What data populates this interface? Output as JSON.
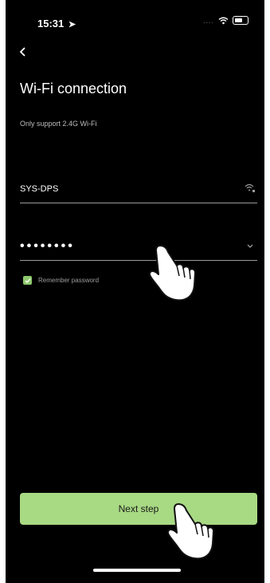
{
  "status_bar": {
    "time": "15:31",
    "location_arrow": "location-arrow-icon",
    "signal_dots": "....",
    "icons": [
      "wifi-icon",
      "battery-icon"
    ]
  },
  "header": {
    "back_icon": "chevron-left-icon",
    "title": "Wi-Fi connection",
    "subtitle": "Only support 2.4G Wi-Fi"
  },
  "form": {
    "ssid_value": "SYS-DPS",
    "password_masked": "••••••••",
    "remember_label": "Remember password",
    "remember_checked": true
  },
  "actions": {
    "next_label": "Next step"
  },
  "colors": {
    "background": "#000000",
    "accent": "#a8d983",
    "checkbox": "#8ec86b"
  }
}
